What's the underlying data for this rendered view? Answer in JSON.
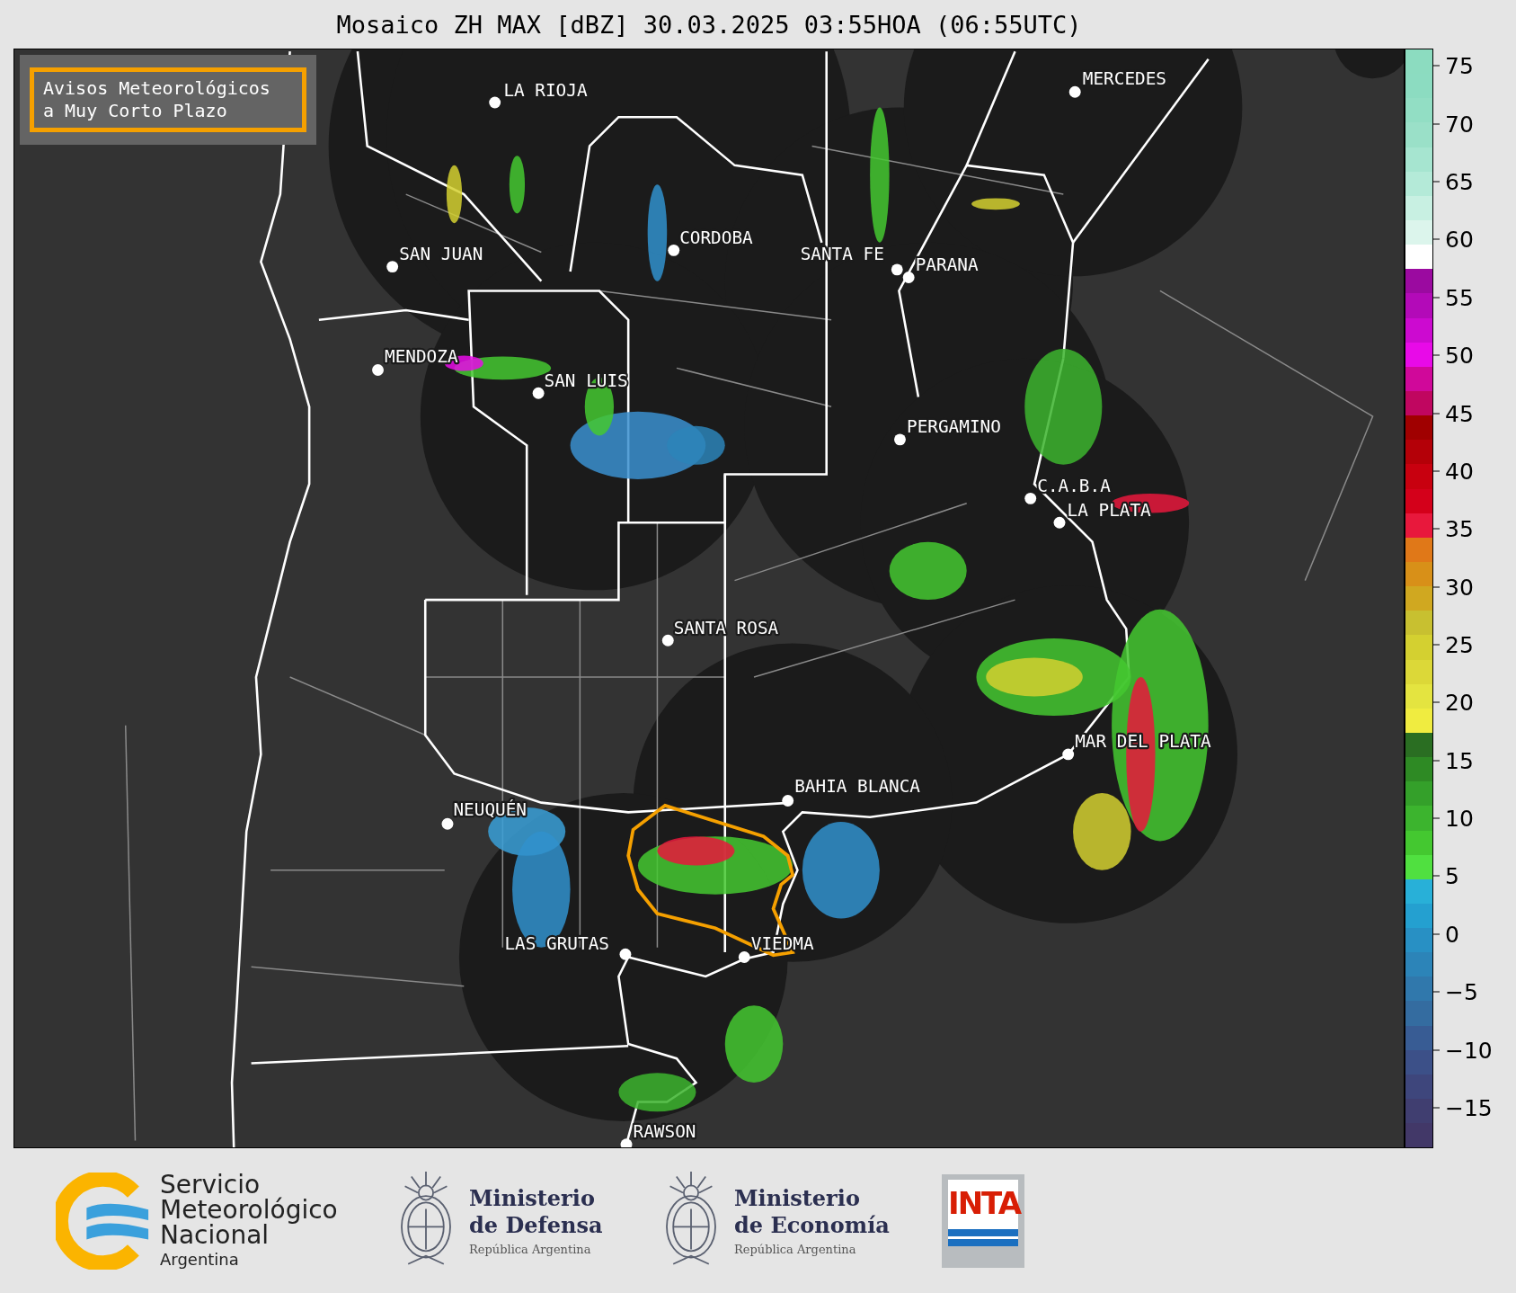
{
  "title": "Mosaico ZH MAX [dBZ] 30.03.2025 03:55HOA (06:55UTC)",
  "map": {
    "notice": "Avisos Meteorológicos\na Muy Corto Plazo",
    "cities": [
      {
        "name": "LA RIOJA"
      },
      {
        "name": "MERCEDES"
      },
      {
        "name": "SAN JUAN"
      },
      {
        "name": "CORDOBA"
      },
      {
        "name": "SANTA FE"
      },
      {
        "name": "PARANA"
      },
      {
        "name": "MENDOZA"
      },
      {
        "name": "SAN LUIS"
      },
      {
        "name": "PERGAMINO"
      },
      {
        "name": "C.A.B.A"
      },
      {
        "name": "LA PLATA"
      },
      {
        "name": "SANTA ROSA"
      },
      {
        "name": "MAR DEL PLATA"
      },
      {
        "name": "BAHIA BLANCA"
      },
      {
        "name": "NEUQUÉN"
      },
      {
        "name": "LAS GRUTAS"
      },
      {
        "name": "VIEDMA"
      },
      {
        "name": "RAWSON"
      }
    ]
  },
  "colorbar": {
    "steps": [
      {
        "color": "#8cdcc0"
      },
      {
        "color": "#8cdcc1"
      },
      {
        "color": "#92dec4"
      },
      {
        "color": "#9ae0c8"
      },
      {
        "color": "#a6e5d0"
      },
      {
        "color": "#b4ead8"
      },
      {
        "color": "#c8f0e2"
      },
      {
        "color": "#dcf5ec"
      },
      {
        "color": "#ffffff"
      },
      {
        "color": "#9b0aa0"
      },
      {
        "color": "#b30ab8"
      },
      {
        "color": "#cc0ad0"
      },
      {
        "color": "#e80ae8"
      },
      {
        "color": "#d0089a"
      },
      {
        "color": "#c00660"
      },
      {
        "color": "#a00000"
      },
      {
        "color": "#b40008"
      },
      {
        "color": "#c8000f"
      },
      {
        "color": "#d4001a"
      },
      {
        "color": "#e8183c"
      },
      {
        "color": "#e07818"
      },
      {
        "color": "#d89018"
      },
      {
        "color": "#d0a820"
      },
      {
        "color": "#c8c030"
      },
      {
        "color": "#d4d030"
      },
      {
        "color": "#dcd838"
      },
      {
        "color": "#e4e440"
      },
      {
        "color": "#f0ec40"
      },
      {
        "color": "#2a6e22"
      },
      {
        "color": "#2e8a24"
      },
      {
        "color": "#34a02a"
      },
      {
        "color": "#3cb42e"
      },
      {
        "color": "#44c830"
      },
      {
        "color": "#50e040"
      },
      {
        "color": "#28b0d8"
      },
      {
        "color": "#24a0d0"
      },
      {
        "color": "#2890c4"
      },
      {
        "color": "#2c84b8"
      },
      {
        "color": "#3078ac"
      },
      {
        "color": "#346ca0"
      },
      {
        "color": "#385c94"
      },
      {
        "color": "#3c5088"
      },
      {
        "color": "#3e467c"
      },
      {
        "color": "#403e70"
      },
      {
        "color": "#423868"
      }
    ],
    "ticks": [
      "75",
      "70",
      "65",
      "60",
      "55",
      "50",
      "45",
      "40",
      "35",
      "30",
      "25",
      "20",
      "15",
      "10",
      "5",
      "0",
      "−5",
      "−10",
      "−15"
    ]
  },
  "logos": [
    {
      "kind": "smn",
      "lines": "Servicio\nMeteorológico\nNacional",
      "subtitle": "Argentina"
    },
    {
      "kind": "ministry",
      "lines": "Ministerio\nde Defensa",
      "subtitle": "República Argentina"
    },
    {
      "kind": "ministry",
      "lines": "Ministerio\nde Economía",
      "subtitle": "República Argentina"
    },
    {
      "kind": "inta",
      "text": "INTA"
    }
  ]
}
